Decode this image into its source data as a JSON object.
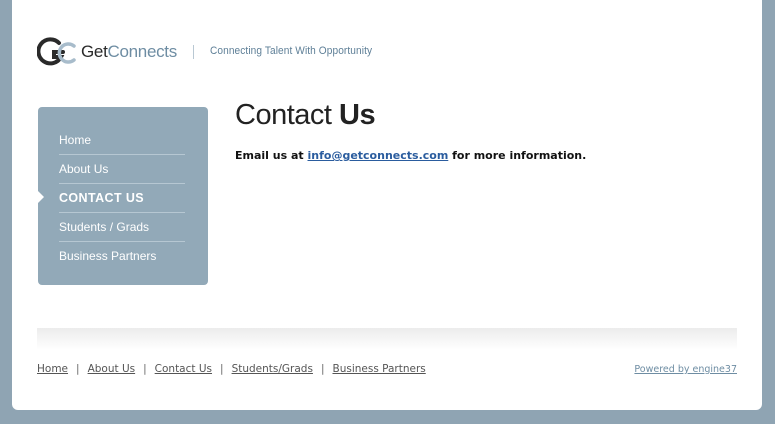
{
  "header": {
    "logo_get": "Get",
    "logo_connects": "Connects",
    "tagline": "Connecting Talent With Opportunity"
  },
  "sidebar": {
    "items": [
      {
        "label": "Home"
      },
      {
        "label": "About Us"
      },
      {
        "label": "CONTACT US"
      },
      {
        "label": "Students / Grads"
      },
      {
        "label": "Business Partners"
      }
    ],
    "active_index": 2
  },
  "main": {
    "title_regular": "Contact ",
    "title_bold": "Us",
    "text_before": "Email us at ",
    "email": "info@getconnects.com",
    "text_after": " for more information."
  },
  "footer": {
    "links": [
      {
        "label": "Home"
      },
      {
        "label": "About Us"
      },
      {
        "label": "Contact Us"
      },
      {
        "label": "Students/Grads"
      },
      {
        "label": "Business Partners"
      }
    ],
    "separator": "|",
    "powered": "Powered by engine37"
  },
  "colors": {
    "background": "#8fa4b3",
    "sidebar": "#92a9b8",
    "brand_blue": "#6e8da3",
    "link": "#2a5c9e"
  }
}
